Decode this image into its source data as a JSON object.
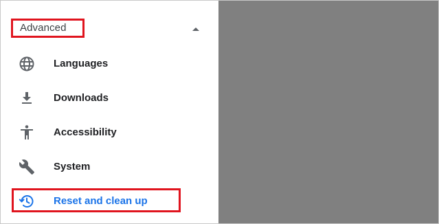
{
  "sidebar": {
    "section": {
      "title": "Advanced",
      "expanded": true,
      "toggle_icon": "chevron-up-icon"
    },
    "items": [
      {
        "label": "Languages",
        "icon": "globe-icon",
        "active": false
      },
      {
        "label": "Downloads",
        "icon": "download-icon",
        "active": false
      },
      {
        "label": "Accessibility",
        "icon": "accessibility-icon",
        "active": false
      },
      {
        "label": "System",
        "icon": "wrench-icon",
        "active": false
      },
      {
        "label": "Reset and clean up",
        "icon": "restore-icon",
        "active": true
      }
    ]
  },
  "colors": {
    "accent": "#1a73e8",
    "text": "#202124",
    "icon": "#5f6368",
    "highlight": "#e0141e",
    "overlay": "#808080"
  }
}
